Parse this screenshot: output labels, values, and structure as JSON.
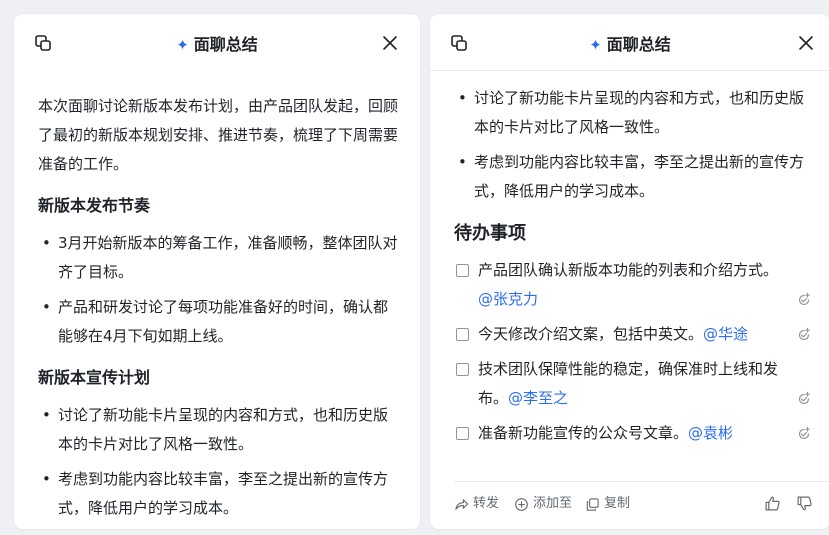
{
  "left_panel": {
    "title": "面聊总结",
    "intro": "本次面聊讨论新版本发布计划，由产品团队发起，回顾了最初的新版本规划安排、推进节奏，梳理了下周需要准备的工作。",
    "section1_title": "新版本发布节奏",
    "section1_items": [
      "3月开始新版本的筹备工作，准备顺畅，整体团队对齐了目标。",
      "产品和研发讨论了每项功能准备好的时间，确认都能够在4月下旬如期上线。"
    ],
    "section2_title": "新版本宣传计划",
    "section2_items": [
      "讨论了新功能卡片呈现的内容和方式，也和历史版本的卡片对比了风格一致性。",
      "考虑到功能内容比较丰富，李至之提出新的宣传方式，降低用户的学习成本。"
    ]
  },
  "right_panel": {
    "title": "面聊总结",
    "items": [
      "讨论了新功能卡片呈现的内容和方式，也和历史版本的卡片对比了风格一致性。",
      "考虑到功能内容比较丰富，李至之提出新的宣传方式，降低用户的学习成本。"
    ],
    "todo_title": "待办事项",
    "todos": [
      {
        "text": "产品团队确认新版本功能的列表和介绍方式。",
        "mention": "@张克力"
      },
      {
        "text": "今天修改介绍文案，包括中英文。",
        "mention": "@华途"
      },
      {
        "text": "技术团队保障性能的稳定，确保准时上线和发布。",
        "mention": "@李至之"
      },
      {
        "text": "准备新功能宣传的公众号文章。",
        "mention": "@袁彬"
      }
    ],
    "footer": {
      "forward": "转发",
      "add_to": "添加至",
      "copy": "复制"
    }
  },
  "colors": {
    "accent": "#2d6cf6",
    "text": "#1f2329",
    "muted": "#646a73"
  }
}
